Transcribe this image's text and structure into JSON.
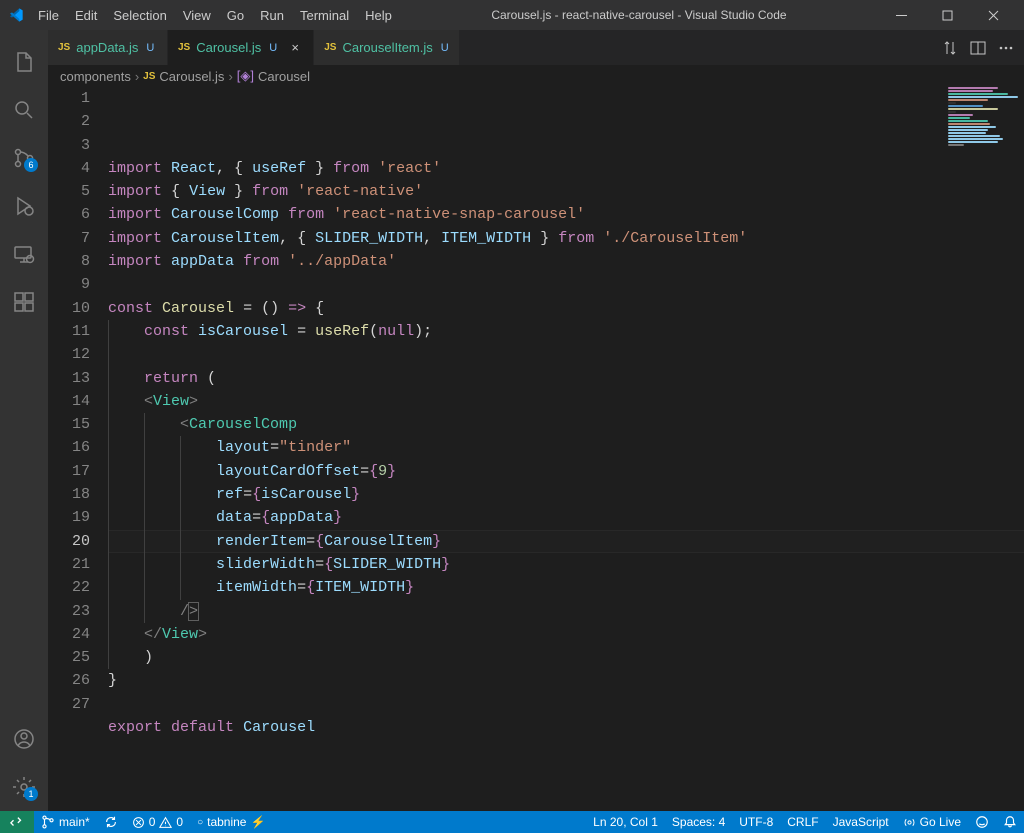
{
  "window": {
    "title": "Carousel.js - react-native-carousel - Visual Studio Code"
  },
  "menu": {
    "items": [
      "File",
      "Edit",
      "Selection",
      "View",
      "Go",
      "Run",
      "Terminal",
      "Help"
    ]
  },
  "activityBar": {
    "sourceControlBadge": "6",
    "settingsBadge": "1"
  },
  "tabs": [
    {
      "icon": "JS",
      "label": "appData.js",
      "modified": "U",
      "active": false
    },
    {
      "icon": "JS",
      "label": "Carousel.js",
      "modified": "U",
      "active": true
    },
    {
      "icon": "JS",
      "label": "CarouselItem.js",
      "modified": "U",
      "active": false
    }
  ],
  "breadcrumb": {
    "folder": "components",
    "file": "Carousel.js",
    "symbol": "Carousel"
  },
  "editor": {
    "currentLine": 20,
    "lines": [
      "import React, { useRef } from 'react'",
      "import { View } from 'react-native'",
      "import CarouselComp from 'react-native-snap-carousel'",
      "import CarouselItem, { SLIDER_WIDTH, ITEM_WIDTH } from './CarouselItem'",
      "import appData from '../appData'",
      "",
      "const Carousel = () => {",
      "    const isCarousel = useRef(null);",
      "",
      "    return (",
      "    <View>",
      "        <CarouselComp",
      "            layout=\"tinder\"",
      "            layoutCardOffset={9}",
      "            ref={isCarousel}",
      "            data={appData}",
      "            renderItem={CarouselItem}",
      "            sliderWidth={SLIDER_WIDTH}",
      "            itemWidth={ITEM_WIDTH}",
      "        />",
      "    </View>",
      "    )",
      "}",
      "",
      "export default Carousel",
      "",
      ""
    ]
  },
  "statusBar": {
    "branch": "main*",
    "errors": "0",
    "warnings": "0",
    "tabnine": "tabnine",
    "position": "Ln 20, Col 1",
    "spaces": "Spaces: 4",
    "encoding": "UTF-8",
    "eol": "CRLF",
    "language": "JavaScript",
    "golive": "Go Live"
  }
}
